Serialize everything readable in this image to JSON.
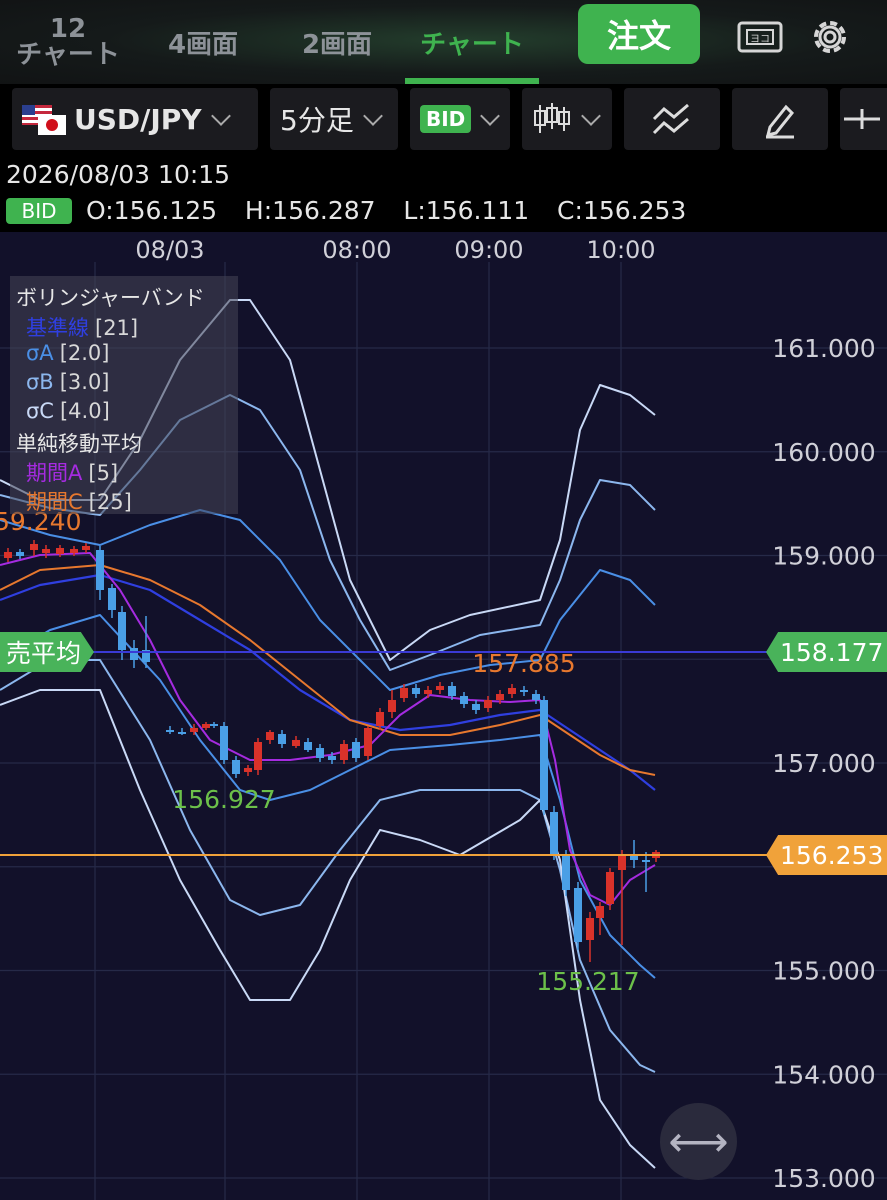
{
  "topnav": {
    "tabs": [
      {
        "label": "12\nチャート"
      },
      {
        "label": "4画面"
      },
      {
        "label": "2画面"
      },
      {
        "label": "チャート"
      }
    ],
    "order_label": "注文"
  },
  "toolbar": {
    "symbol": "USD/JPY",
    "timeframe": "5分足",
    "price_type": "BID"
  },
  "ohlc": {
    "timestamp": "2026/08/03 10:15",
    "badge": "BID",
    "values": "O:156.125  H:156.287  L:156.111  C:156.253"
  },
  "chart": {
    "time_labels": [
      "08/03",
      "08:00",
      "09:00",
      "10:00"
    ],
    "price_labels": [
      "161.000",
      "160.000",
      "159.000",
      "157.000",
      "155.000",
      "154.000",
      "153.000"
    ],
    "annotations": {
      "prev_high": "59.240",
      "high": "157.885",
      "low1": "156.927",
      "low2": "155.217"
    },
    "avg_sell_label": "売平均",
    "avg_sell_price": "158.177",
    "current_price": "156.253",
    "colors": {
      "avg_sell_line": "#3a3ad6",
      "current_line": "#f0a23a",
      "badge_green": "#49b35a",
      "badge_orange": "#f0a23a",
      "candle_up": "#d9322a",
      "candle_down": "#4a9fe6"
    }
  },
  "legend": {
    "bb_title": "ボリンジャーバンド",
    "bb_items": [
      {
        "label": "基準線",
        "param": "[21]",
        "color": "#2f3fe0"
      },
      {
        "label": "σA",
        "param": "[2.0]",
        "color": "#4a8fe6"
      },
      {
        "label": "σB",
        "param": "[3.0]",
        "color": "#8cb7ee"
      },
      {
        "label": "σC",
        "param": "[4.0]",
        "color": "#c9d9f6"
      }
    ],
    "sma_title": "単純移動平均",
    "sma_items": [
      {
        "label": "期間A",
        "param": "[5]",
        "color": "#a52be0"
      },
      {
        "label": "期間C",
        "param": "[25]",
        "color": "#e7782e"
      }
    ]
  }
}
